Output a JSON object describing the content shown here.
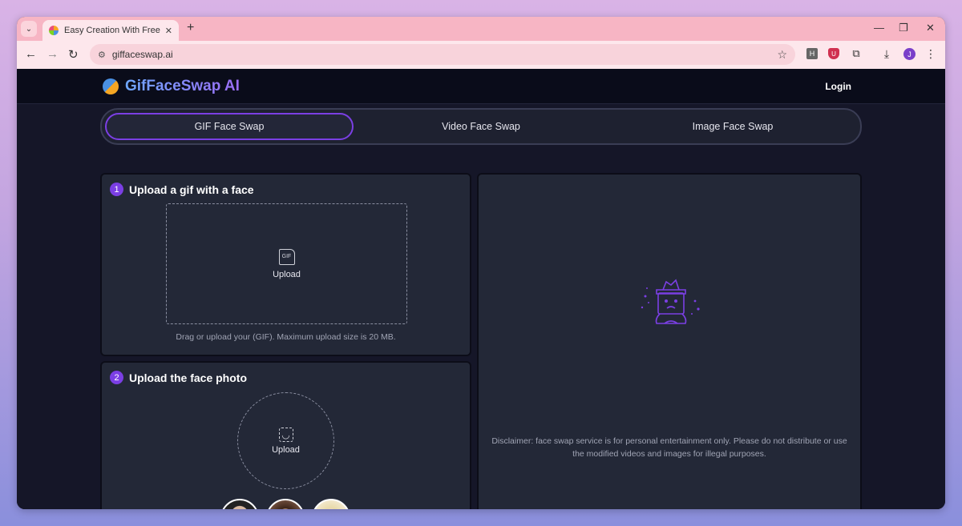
{
  "browser": {
    "tab_title": "Easy Creation With Free Unlimi",
    "url": "giffaceswap.ai",
    "profile_initial": "J",
    "ext_h": "H"
  },
  "header": {
    "logo_text": "GifFaceSwap AI",
    "login_label": "Login"
  },
  "modes": {
    "items": [
      {
        "label": "GIF Face Swap"
      },
      {
        "label": "Video Face Swap"
      },
      {
        "label": "Image Face Swap"
      }
    ],
    "active": "GIF Face Swap"
  },
  "step1": {
    "number": "1",
    "title": "Upload a gif with a face",
    "file_icon_text": "GIF",
    "upload_label": "Upload",
    "hint": "Drag or upload your (GIF). Maximum upload size is 20 MB."
  },
  "step2": {
    "number": "2",
    "title": "Upload the face photo",
    "upload_label": "Upload"
  },
  "result": {
    "disclaimer_line1": "Disclaimer: face swap service is for personal entertainment only. Please do not distribute or use",
    "disclaimer_line2": "the modified videos and images for illegal purposes."
  },
  "colors": {
    "accent": "#7b3fe4",
    "panel_bg": "#232837",
    "page_bg": "#151628"
  }
}
